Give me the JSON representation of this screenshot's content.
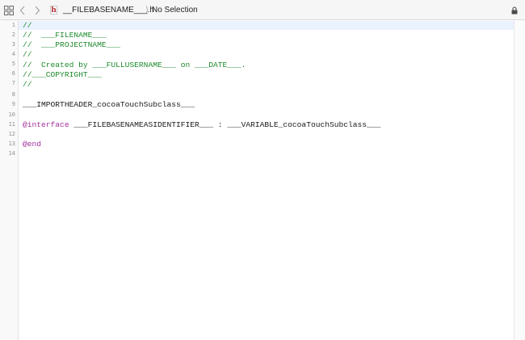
{
  "jumpbar": {
    "file_name": "__FILEBASENAME___.h",
    "separator": "⟩",
    "selection": "No Selection"
  },
  "icons": {
    "grid": "related-items-grid-icon",
    "back": "chevron-left-icon",
    "forward": "chevron-right-icon",
    "file": "header-file-h-icon",
    "file_letter": "h",
    "lock": "lock-icon"
  },
  "colors": {
    "comment": "#1e8a2c",
    "keyword": "#a3309b",
    "text": "#1a1a1a",
    "line_number": "#8f8f8f",
    "current_line": "#eaf2ff"
  },
  "editor": {
    "line_numbers": [
      "1",
      "2",
      "3",
      "4",
      "5",
      "6",
      "7",
      "8",
      "9",
      "10",
      "11",
      "12",
      "13",
      "14"
    ],
    "lines": {
      "l1": "//",
      "l2": "//  ___FILENAME___",
      "l3": "//  ___PROJECTNAME___",
      "l4": "//",
      "l5": "//  Created by ___FULLUSERNAME___ on ___DATE___.",
      "l6": "//___COPYRIGHT___",
      "l7": "//",
      "l9": "___IMPORTHEADER_cocoaTouchSubclass___",
      "l11_keyword": "@interface",
      "l11_rest": " ___FILEBASENAMEASIDENTIFIER___ : ___VARIABLE_cocoaTouchSubclass___",
      "l13_keyword": "@end"
    }
  }
}
